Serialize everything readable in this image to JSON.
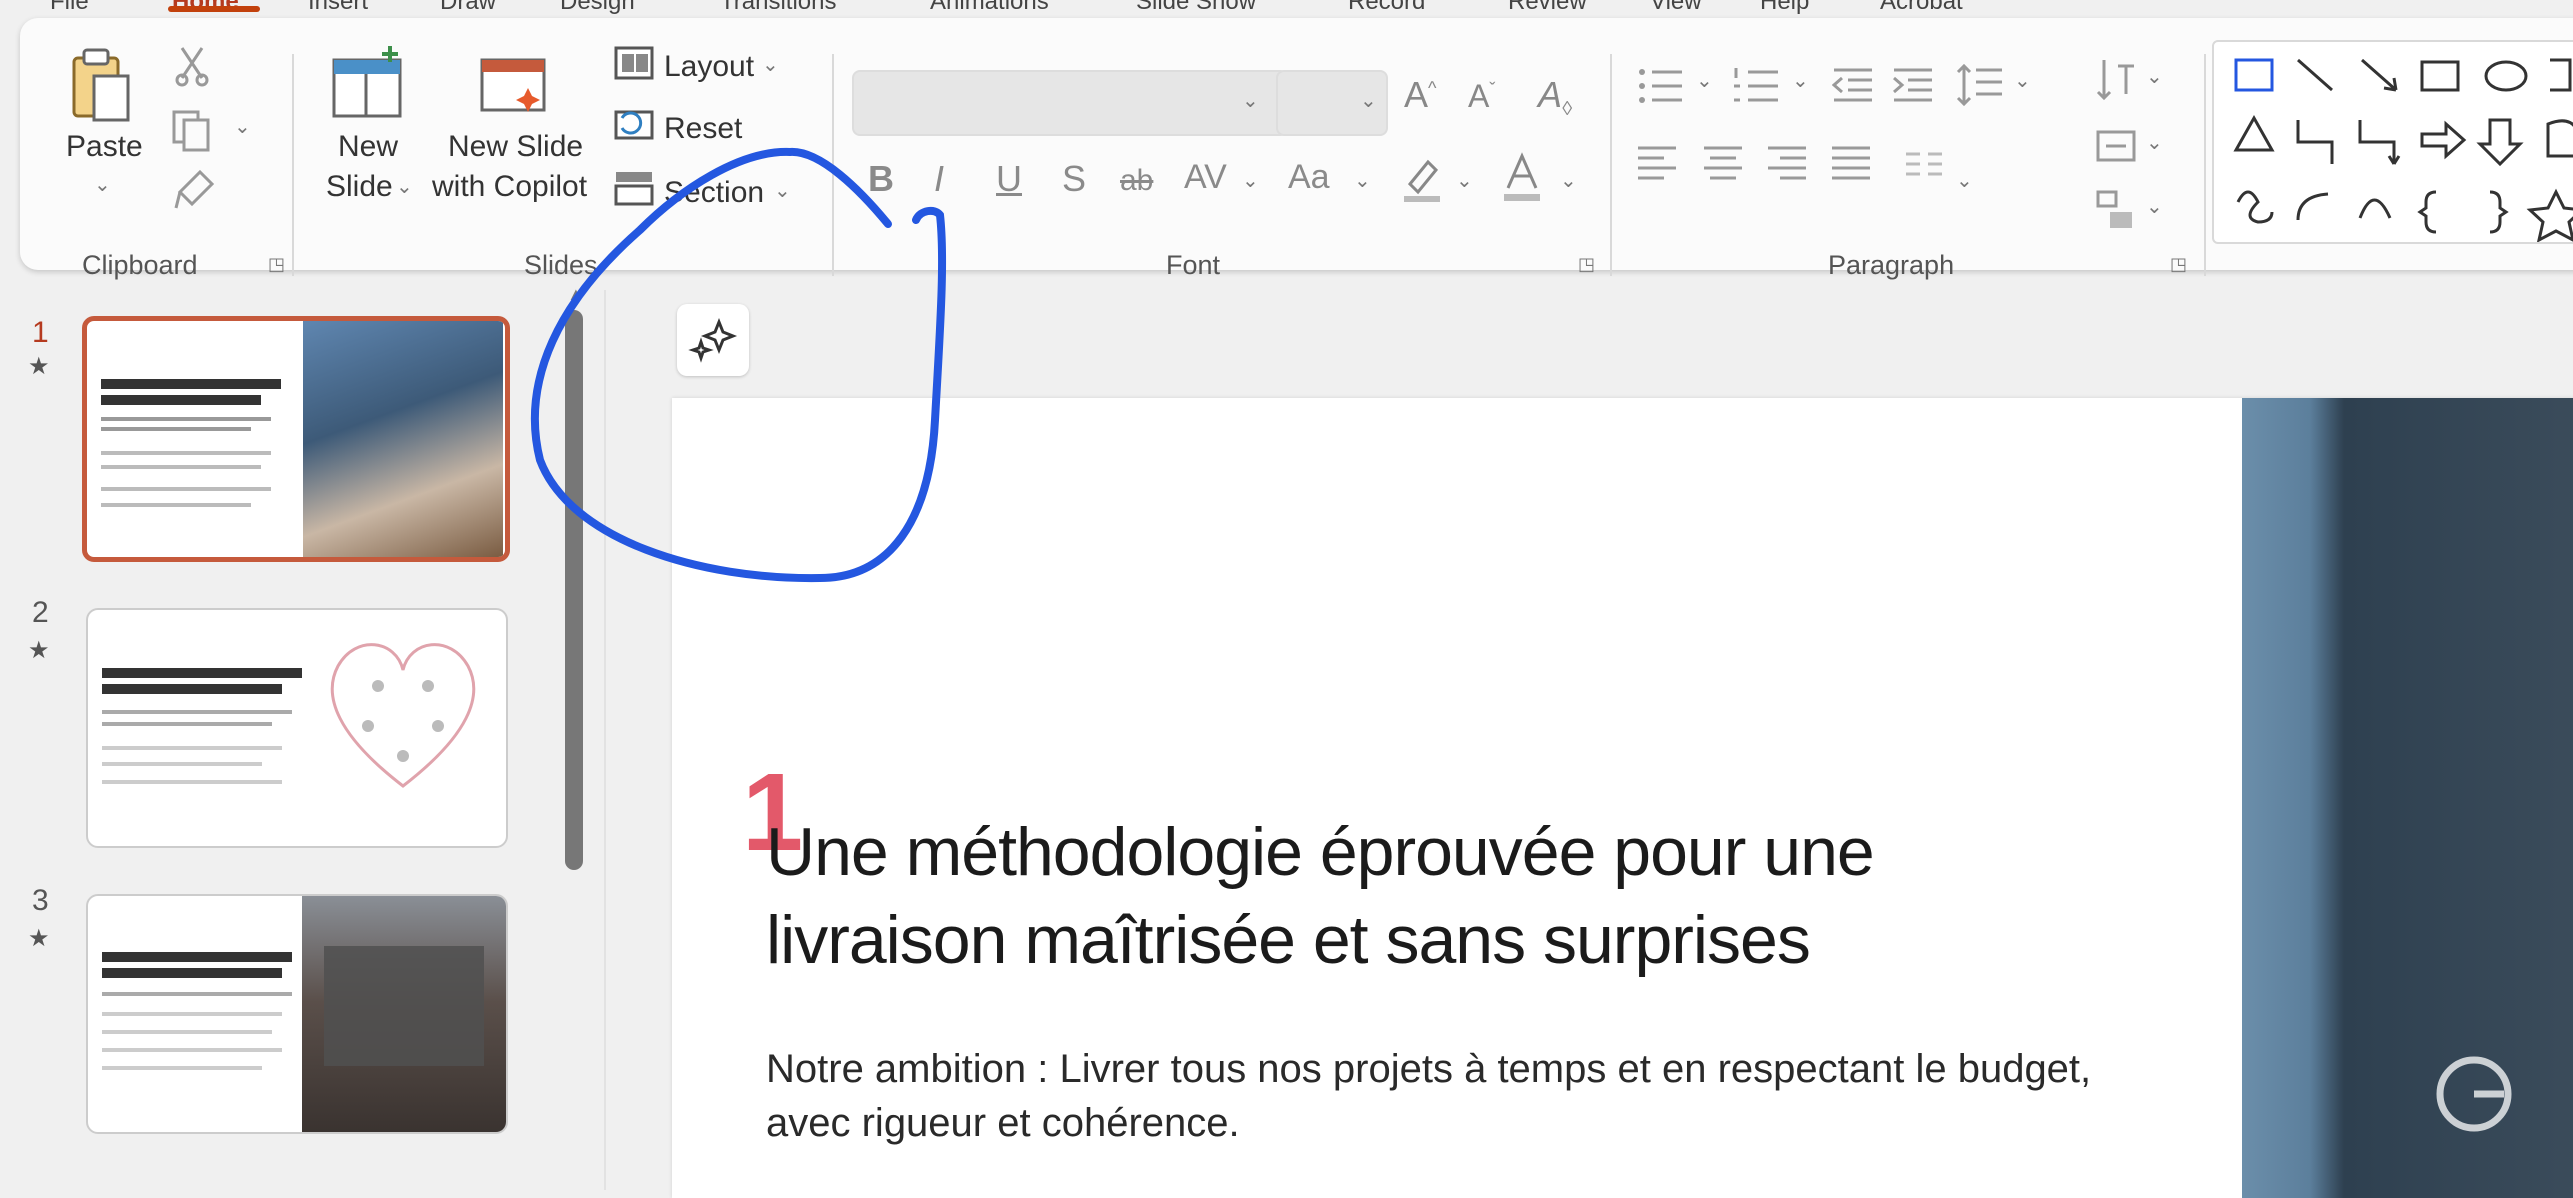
{
  "ribbon": {
    "tabs": [
      "File",
      "Home",
      "Insert",
      "Draw",
      "Design",
      "Transitions",
      "Animations",
      "Slide Show",
      "Record",
      "Review",
      "View",
      "Help",
      "Acrobat"
    ],
    "clipboard": {
      "paste_label": "Paste",
      "group_label": "Clipboard"
    },
    "slides": {
      "new_slide_line1": "New",
      "new_slide_line2": "Slide",
      "new_slide_copilot_line1": "New Slide",
      "new_slide_copilot_line2": "with Copilot",
      "layout_label": "Layout",
      "reset_label": "Reset",
      "section_label": "Section",
      "group_label": "Slides"
    },
    "font": {
      "group_label": "Font",
      "bold": "B",
      "italic": "I",
      "underline": "U",
      "shadow": "S",
      "strike": "ab",
      "spacing": "AV",
      "case": "Aa"
    },
    "paragraph": {
      "group_label": "Paragraph"
    }
  },
  "slides_panel": {
    "items": [
      {
        "number": "1",
        "star": "★",
        "selected": true
      },
      {
        "number": "2",
        "star": "★",
        "selected": false
      },
      {
        "number": "3",
        "star": "★",
        "selected": false
      }
    ]
  },
  "slide": {
    "number": "1",
    "title": "Une méthodologie éprouvée pour une livraison maîtrisée et sans surprises",
    "subtitle": "Notre ambition : Livrer tous nos projets à temps et en respectant le budget, avec rigueur et cohérence."
  },
  "colors": {
    "accent": "#c2410c",
    "annotation": "#2457e0",
    "slide_number": "#e0485a"
  }
}
